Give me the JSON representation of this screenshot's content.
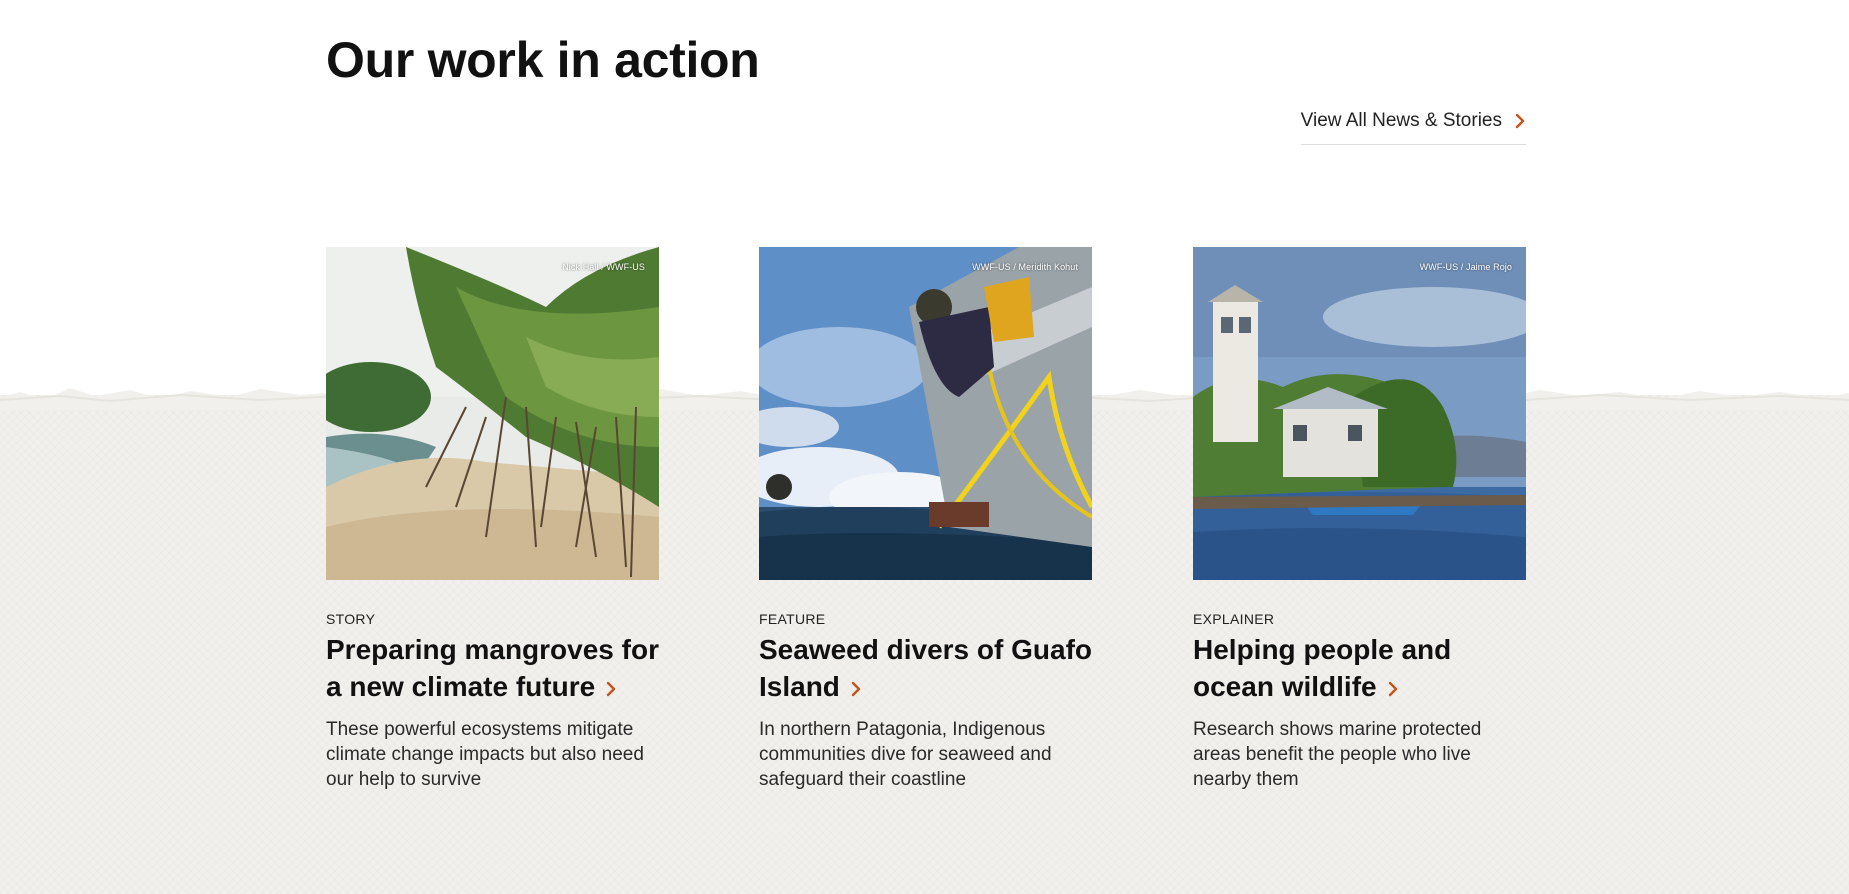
{
  "section": {
    "title": "Our work in action",
    "view_all_label": "View All News & Stories"
  },
  "colors": {
    "accent": "#c4541c",
    "background_band": "#f1f0ec",
    "text": "#111111"
  },
  "cards": [
    {
      "type": "STORY",
      "title": "Preparing mangroves for a new climate future",
      "description": "These powerful ecosystems mitigate climate change impacts but also need our help to survive",
      "credit": "Nick Hall / WWF-US",
      "image_subject": "mangroves on a sandy beach"
    },
    {
      "type": "FEATURE",
      "title": "Seaweed divers of Guafo Island",
      "description": "In northern Patagonia, Indigenous communities dive for seaweed and safeguard their coastline",
      "credit": "WWF-US / Meridith Kohut",
      "image_subject": "diver climbing aboard a boat with yellow rope"
    },
    {
      "type": "EXPLAINER",
      "title": "Helping people and ocean wildlife",
      "description": "Research shows marine protected areas benefit the people who live nearby them",
      "credit": "WWF-US / Jaime Rojo",
      "image_subject": "lighthouse house on a small island with trees"
    }
  ]
}
